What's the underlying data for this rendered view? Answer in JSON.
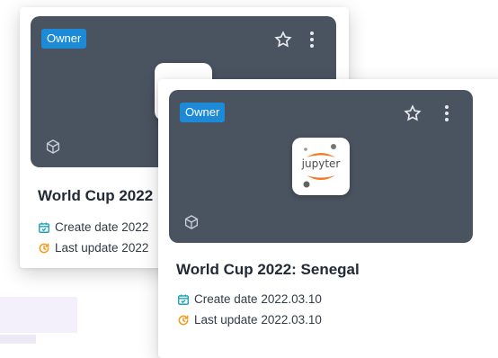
{
  "back_card": {
    "badge": "Owner",
    "title": "World Cup 2022",
    "create_label": "Create date 2022",
    "update_label": "Last update 2022",
    "logo_icon": "jupyter-logo-icon"
  },
  "front_card": {
    "badge": "Owner",
    "title": "World Cup 2022: Senegal",
    "create_label": "Create date",
    "create_value": "2022.03.10",
    "update_label": "Last update",
    "update_value": "2022.03.10",
    "logo_text": "jupyter",
    "logo_icon": "jupyter-logo-icon"
  },
  "colors": {
    "thumbnail_bg": "#4a5360",
    "badge_bg": "#1c8ad6",
    "calendar_icon": "#1aa3b8",
    "update_icon": "#f29b1b",
    "jupyter_orange": "#f37726"
  }
}
